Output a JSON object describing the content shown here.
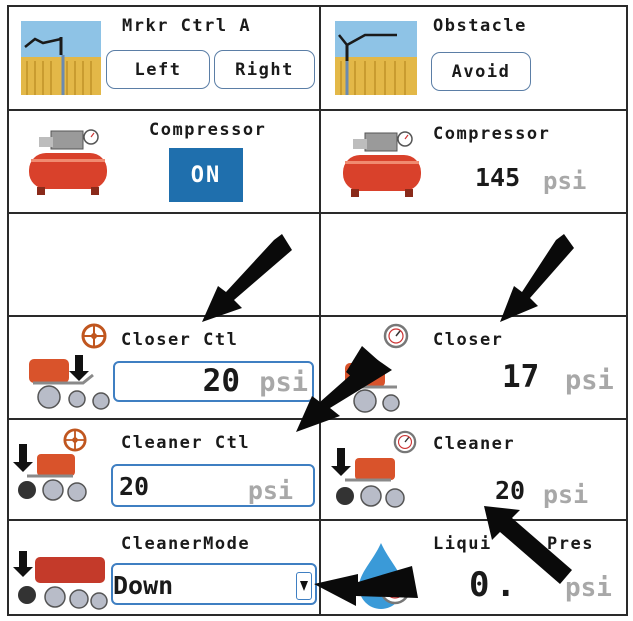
{
  "marker": {
    "title": "Mrkr Ctrl A",
    "left_label": "Left",
    "right_label": "Right"
  },
  "obstacle": {
    "title": "Obstacle",
    "avoid_label": "Avoid"
  },
  "compressor_ctl": {
    "title": "Compressor",
    "toggle_label": "ON"
  },
  "compressor": {
    "title": "Compressor",
    "value": "145",
    "unit": "psi"
  },
  "closer_ctl": {
    "title": "Closer Ctl",
    "value": "20",
    "unit": "psi"
  },
  "closer": {
    "title": "Closer",
    "value": "17",
    "unit": "psi"
  },
  "cleaner_ctl": {
    "title": "Cleaner Ctl",
    "value": "20",
    "unit": "psi"
  },
  "cleaner": {
    "title": "Cleaner",
    "value": "20",
    "unit": "psi"
  },
  "cleaner_mode": {
    "title": "CleanerMode",
    "selected": "Down"
  },
  "liquid": {
    "title": "Liqui",
    "title_tail": "Pres",
    "value": "0.",
    "unit": "psi"
  },
  "colors": {
    "accent": "#1f6fad",
    "field_border": "#3f7fc2",
    "unit_gray": "#a8a8a8"
  }
}
